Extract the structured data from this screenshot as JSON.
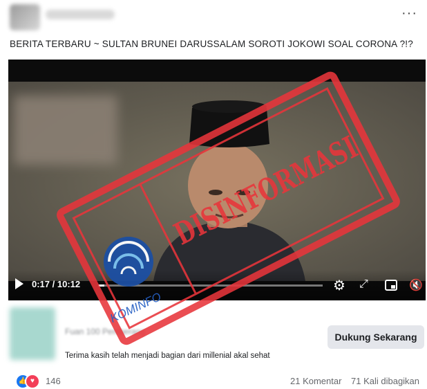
{
  "post": {
    "text": "BERITA TERBARU ~ SULTAN BRUNEI DARUSSALAM SOROTI JOKOWI SOAL CORONA ?!?",
    "more_label": "···"
  },
  "video": {
    "time": "0:17 / 10:12",
    "progress_fraction": 0.027,
    "gear_icon": "⚙",
    "expand_icon": "⤢",
    "mute_icon": "🔇"
  },
  "stamp": {
    "label": "DISINFORMASI",
    "logo_text": "KOMINFO",
    "color": "#e8353b"
  },
  "support": {
    "page_text": "Fuan 100 Pemberang",
    "button_label": "Dukung Sekarang",
    "thanks_text": "Terima kasih telah menjadi bagian dari millenial akal sehat"
  },
  "footer": {
    "reaction_count": "146",
    "comments": "21 Komentar",
    "shares": "71 Kali dibagikan",
    "like_icon": "👍",
    "love_icon": "♥"
  }
}
